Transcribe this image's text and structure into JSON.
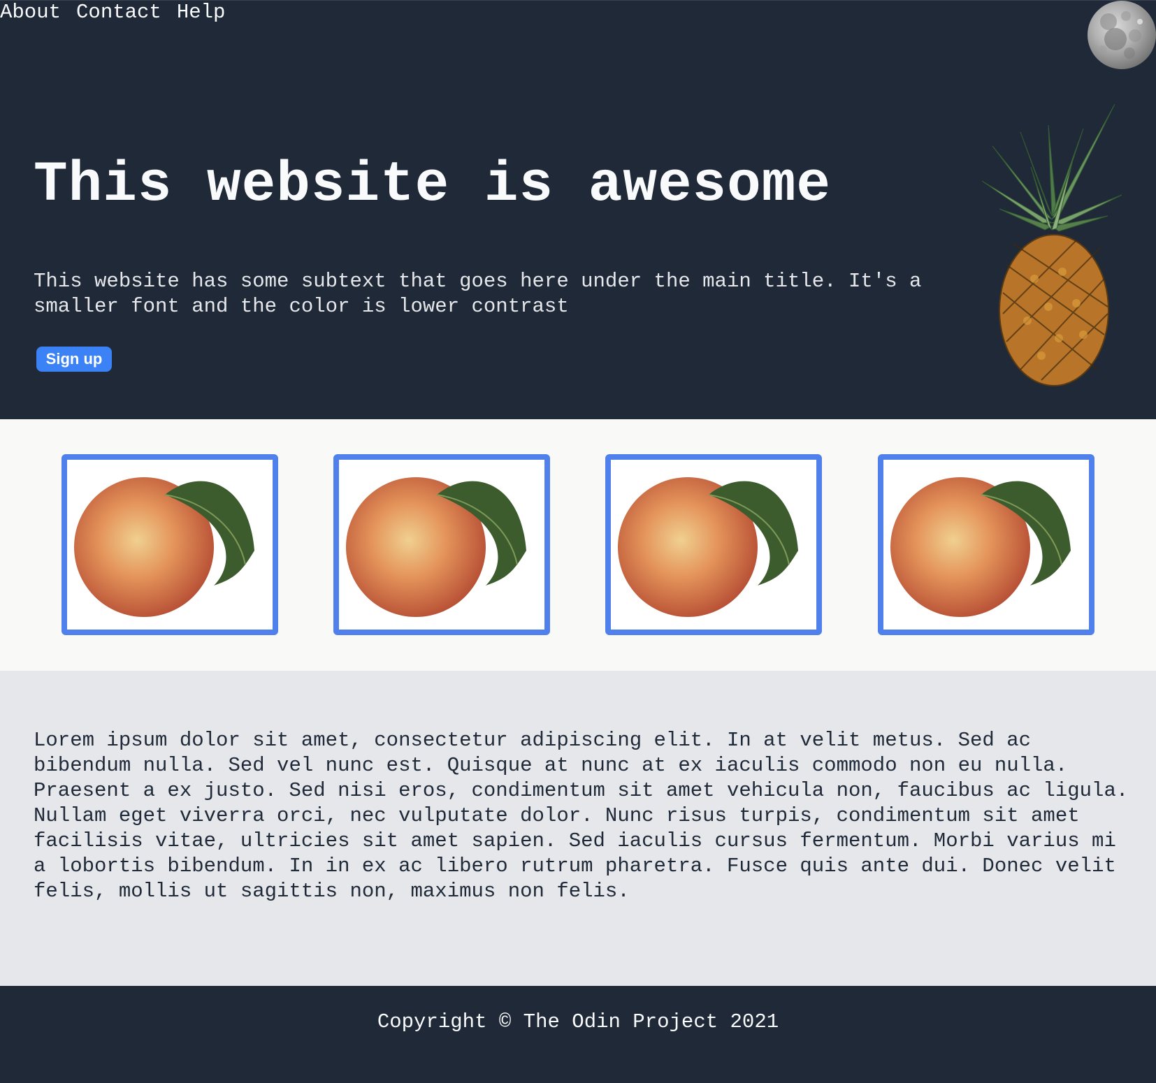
{
  "nav": {
    "links": [
      "About",
      "Contact",
      "Help"
    ]
  },
  "header": {
    "avatar_icon": "moon-icon"
  },
  "hero": {
    "title": "This website is awesome",
    "subtitle": "This website has some subtext that goes here under the main title. It's a smaller font and the color is lower contrast",
    "signup_label": "Sign up",
    "image": "pineapple-image"
  },
  "cards": {
    "items": [
      {
        "image": "peach-image"
      },
      {
        "image": "peach-image"
      },
      {
        "image": "peach-image"
      },
      {
        "image": "peach-image"
      }
    ]
  },
  "content": {
    "paragraph": "Lorem ipsum dolor sit amet, consectetur adipiscing elit. In at velit metus. Sed ac bibendum nulla. Sed vel nunc est. Quisque at nunc at ex iaculis commodo non eu nulla. Praesent a ex justo. Sed nisi eros, condimentum sit amet vehicula non, faucibus ac ligula. Nullam eget viverra orci, nec vulputate dolor. Nunc risus turpis, condimentum sit amet facilisis vitae, ultricies sit amet sapien. Sed iaculis cursus fermentum. Morbi varius mi a lobortis bibendum. In in ex ac libero rutrum pharetra. Fusce quis ante dui. Donec velit felis, mollis ut sagittis non, maximus non felis."
  },
  "footer": {
    "copyright": "Copyright © The Odin Project 2021"
  },
  "colors": {
    "dark_bg": "#1f2937",
    "light_bg": "#f9f9f7",
    "gray_bg": "#e5e7eb",
    "accent": "#3b82f6",
    "card_border": "#4f80ec"
  }
}
